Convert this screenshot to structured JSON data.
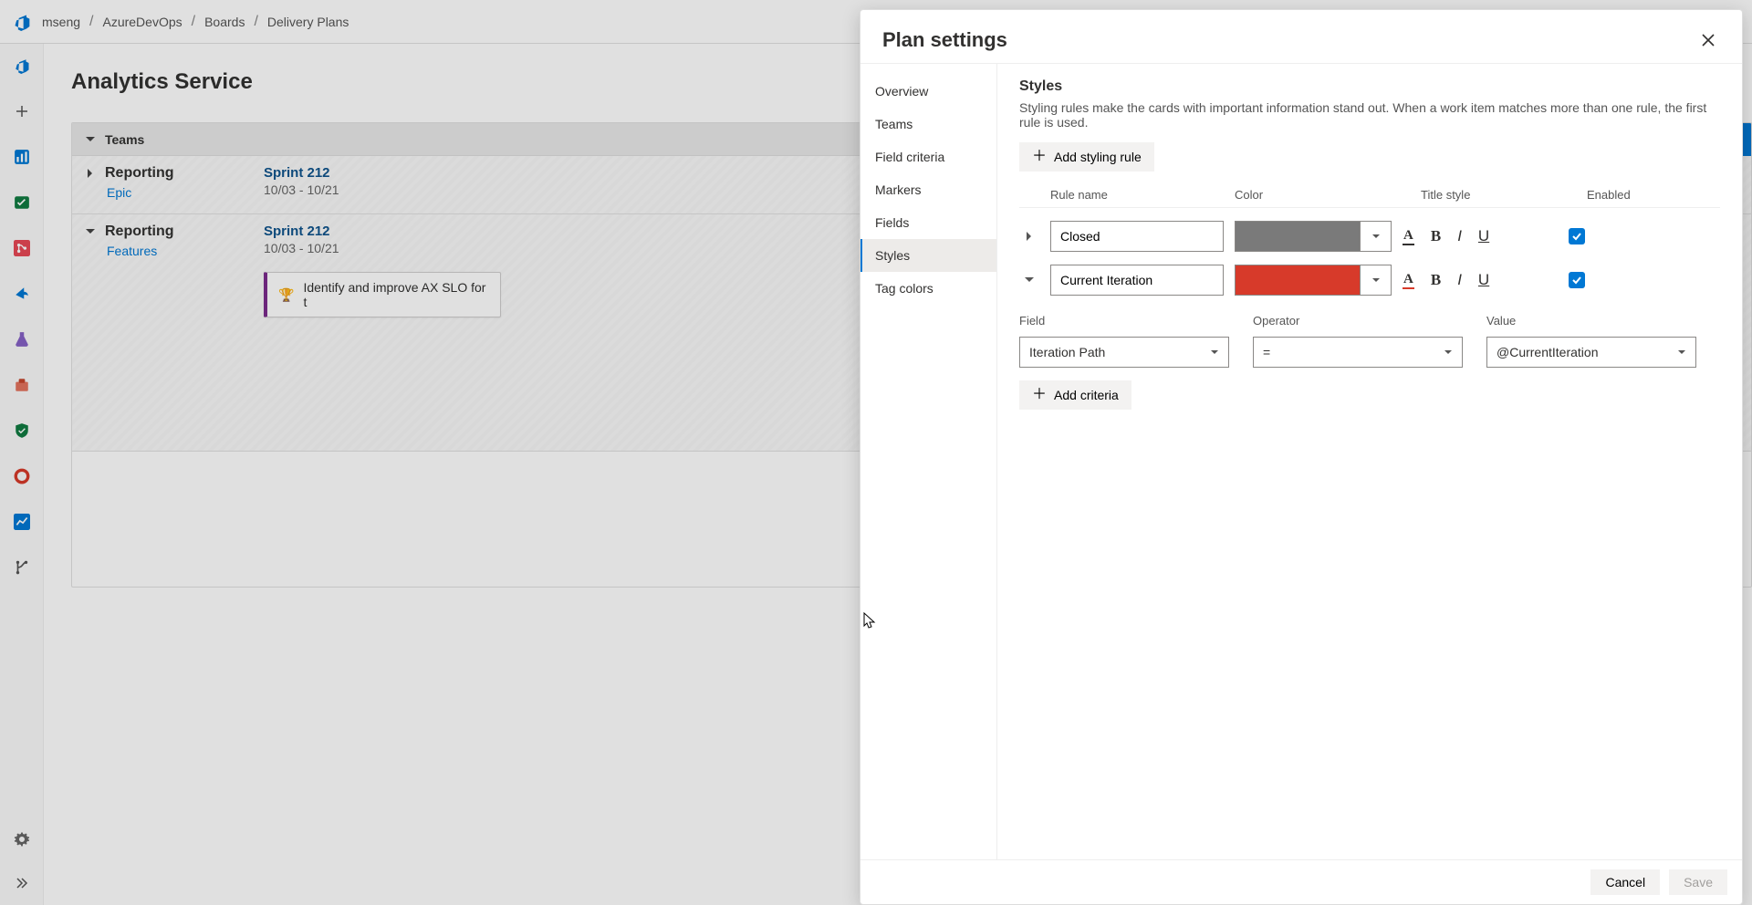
{
  "breadcrumbs": [
    "mseng",
    "AzureDevOps",
    "Boards",
    "Delivery Plans"
  ],
  "page": {
    "title": "Analytics Service"
  },
  "teams_header": {
    "label": "Teams"
  },
  "lanes": [
    {
      "name": "Reporting",
      "sub": "Epic",
      "sprint": "Sprint 212",
      "dates": "10/03 - 10/21"
    },
    {
      "name": "Reporting",
      "sub": "Features",
      "sprint": "Sprint 212",
      "dates": "10/03 - 10/21",
      "card": "Identify and improve AX SLO for t"
    }
  ],
  "panel": {
    "title": "Plan settings",
    "nav": [
      "Overview",
      "Teams",
      "Field criteria",
      "Markers",
      "Fields",
      "Styles",
      "Tag colors"
    ],
    "nav_selected": "Styles",
    "section_title": "Styles",
    "section_desc": "Styling rules make the cards with important information stand out. When a work item matches more than one rule, the first rule is used.",
    "add_rule_label": "Add styling rule",
    "columns": {
      "rule": "Rule name",
      "color": "Color",
      "title": "Title style",
      "enabled": "Enabled"
    },
    "rules": [
      {
        "expanded": false,
        "name": "Closed",
        "color": "#7a7a7a",
        "title_color_red": false,
        "enabled": true
      },
      {
        "expanded": true,
        "name": "Current Iteration",
        "color": "#d73a2a",
        "title_color_red": true,
        "enabled": true
      }
    ],
    "criteria_columns": {
      "field": "Field",
      "operator": "Operator",
      "value": "Value"
    },
    "criteria": {
      "field": "Iteration Path",
      "operator": "=",
      "value": "@CurrentIteration"
    },
    "add_criteria_label": "Add criteria",
    "footer": {
      "cancel": "Cancel",
      "save": "Save"
    }
  }
}
